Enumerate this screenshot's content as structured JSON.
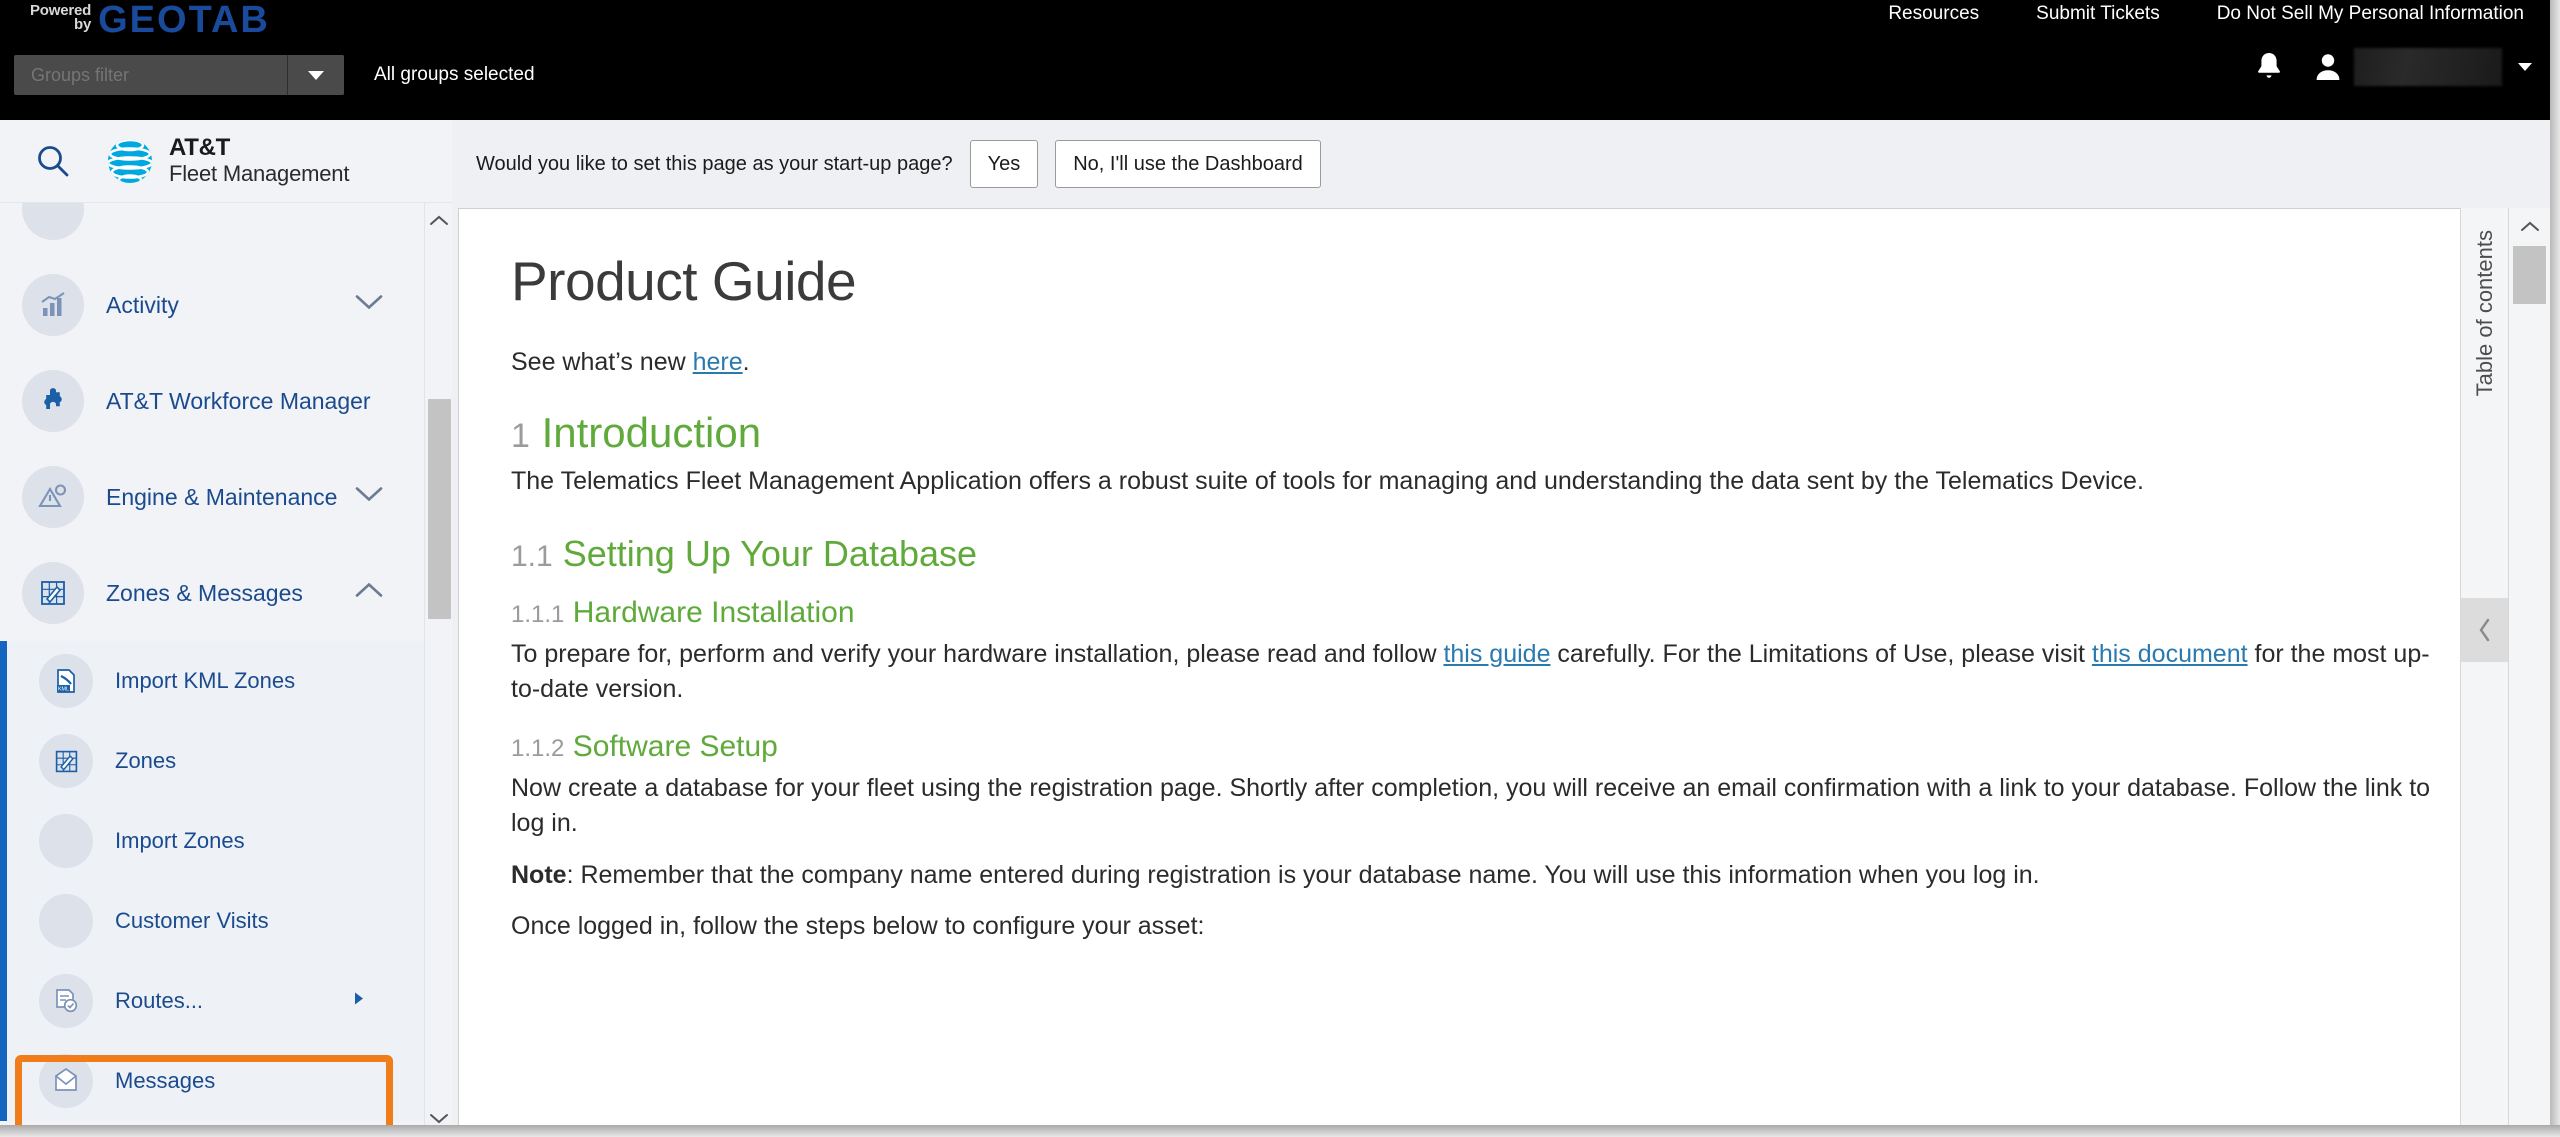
{
  "topbar": {
    "powered_line1": "Powered",
    "powered_line2": "by",
    "brand_word": "GEOTAB",
    "groups_filter_placeholder": "Groups filter",
    "groups_filter_value": "",
    "all_groups_selected": "All groups selected",
    "nav_links": [
      {
        "label": "Resources"
      },
      {
        "label": "Submit Tickets"
      },
      {
        "label": "Do Not Sell My Personal Information"
      }
    ],
    "bell_icon": "bell-icon",
    "person_icon": "person-icon",
    "user_name": "",
    "user_caret_icon": "caret-down-icon"
  },
  "sidebar": {
    "search_icon": "search-icon",
    "brand_line1": "AT&T",
    "brand_line2": "Fleet Management",
    "items": [
      {
        "label": "",
        "icon": "partial-item-icon",
        "chevron": "",
        "partial": true
      },
      {
        "label": "Activity",
        "icon": "bar-chart-icon",
        "chevron": "chevron-down-icon"
      },
      {
        "label": "AT&T Workforce Manager",
        "icon": "puzzle-piece-icon",
        "chevron": ""
      },
      {
        "label": "Engine & Maintenance",
        "icon": "engine-warning-icon",
        "chevron": "chevron-down-icon"
      },
      {
        "label": "Zones & Messages",
        "icon": "zones-grid-icon",
        "chevron": "chevron-up-icon"
      }
    ],
    "subitems": [
      {
        "label": "Import KML Zones",
        "icon": "kml-file-icon",
        "arrow": ""
      },
      {
        "label": "Zones",
        "icon": "zones-grid-icon",
        "arrow": ""
      },
      {
        "label": "Import Zones",
        "icon": "blank-icon",
        "arrow": ""
      },
      {
        "label": "Customer Visits",
        "icon": "blank-icon",
        "arrow": ""
      },
      {
        "label": "Routes...",
        "icon": "routes-icon",
        "arrow": "arrow-right-icon",
        "highlighted": true
      },
      {
        "label": "Messages",
        "icon": "envelope-icon",
        "arrow": ""
      }
    ],
    "scroll_up_icon": "chevron-up-icon",
    "scroll_down_icon": "chevron-down-icon"
  },
  "banner": {
    "question": "Would you like to set this page as your start-up page?",
    "yes_label": "Yes",
    "no_label": "No, I'll use the Dashboard"
  },
  "document": {
    "title": "Product Guide",
    "whats_new_prefix": "See what’s new ",
    "whats_new_link": "here",
    "whats_new_suffix": ".",
    "sections": [
      {
        "number": "1",
        "heading": "Introduction",
        "level": 1,
        "body": "The Telematics Fleet Management Application offers a robust suite of tools for managing and understanding the data sent by the Telematics Device."
      },
      {
        "number": "1.1",
        "heading": "Setting Up Your Database",
        "level": 2,
        "body": ""
      },
      {
        "number": "1.1.1",
        "heading": "Hardware Installation",
        "level": 3,
        "body_parts": [
          {
            "text": "To prepare for, perform and verify your hardware installation, please read and follow "
          },
          {
            "text": "this guide",
            "link": true
          },
          {
            "text": " carefully. For the Limitations of Use, please visit "
          },
          {
            "text": "this document",
            "link": true
          },
          {
            "text": " for the most up-to-date version."
          }
        ]
      },
      {
        "number": "1.1.2",
        "heading": "Software Setup",
        "level": 3,
        "body": "Now create a database for your fleet using the registration page. Shortly after completion, you will receive an email confirmation with a link to your database. Follow the link to log in.",
        "note_label": "Note",
        "note_text": ": Remember that the company name entered during registration is your database name. You will use this information when you log in.",
        "closing": "Once logged in, follow the steps below to configure your asset:"
      }
    ]
  },
  "toc": {
    "label": "Table of contents",
    "collapse_icon": "chevron-left-icon",
    "scroll_up_icon": "chevron-up-icon"
  },
  "colors": {
    "topbar_bg": "#000000",
    "geotab_blue": "#1a4a9c",
    "sidebar_bg": "#f1f3f6",
    "nav_link_blue": "#1b4b8f",
    "submenu_accent": "#1565c0",
    "highlight_orange": "#f07c1a",
    "heading_green": "#5faa3a",
    "section_number_gray": "#9b9b9b",
    "doc_link_blue": "#2a7ab0",
    "att_globe_blue": "#00a8e0"
  }
}
